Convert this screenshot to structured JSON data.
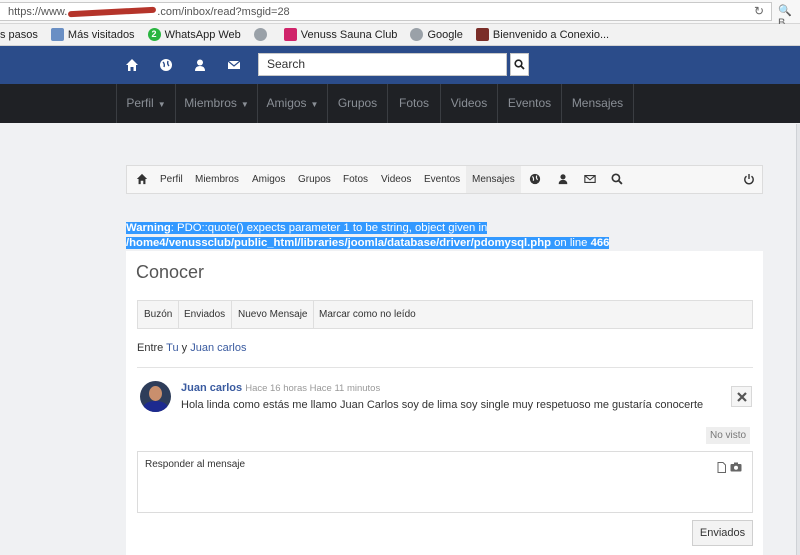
{
  "browser": {
    "url_prefix": "https://www.",
    "url_suffix": ".com/inbox/read?msgid=28",
    "reload_icon": "reload-icon",
    "search_glyph": "🔍 B"
  },
  "bookmarks": [
    {
      "label": "s pasos",
      "icon": "folder-icon"
    },
    {
      "label": "Más visitados",
      "icon": "folder-icon"
    },
    {
      "label": "WhatsApp Web",
      "icon": "whatsapp-icon"
    },
    {
      "label": "",
      "icon": "globe-icon"
    },
    {
      "label": "Venuss Sauna Club",
      "icon": "venuss-icon"
    },
    {
      "label": "Google",
      "icon": "globe-icon"
    },
    {
      "label": "Bienvenido a Conexio...",
      "icon": "joomla-icon"
    }
  ],
  "header": {
    "search_placeholder": "Search"
  },
  "nav": [
    {
      "label": "Perfil",
      "caret": true
    },
    {
      "label": "Miembros",
      "caret": true
    },
    {
      "label": "Amigos",
      "caret": true
    },
    {
      "label": "Grupos",
      "caret": false
    },
    {
      "label": "Fotos",
      "caret": false
    },
    {
      "label": "Videos",
      "caret": false
    },
    {
      "label": "Eventos",
      "caret": false
    },
    {
      "label": "Mensajes",
      "caret": false
    }
  ],
  "toolbar": {
    "items": [
      "Perfil",
      "Miembros",
      "Amigos",
      "Grupos",
      "Fotos",
      "Videos",
      "Eventos",
      "Mensajes"
    ],
    "active": "Mensajes"
  },
  "warning": {
    "label": "Warning",
    "text": ": PDO::quote() expects parameter 1 to be string, object given in ",
    "path": "/home4/venussclub/public_html/libraries/joomla/database/driver/pdomysql.php",
    "on_line": " on line ",
    "line": "466"
  },
  "inbox": {
    "title": "Conocer",
    "tabs": [
      "Buzón",
      "Enviados",
      "Nuevo Mensaje",
      "Marcar como no leído"
    ],
    "between_prefix": "Entre ",
    "between_you": "Tu",
    "between_and": " y ",
    "between_other": "Juan carlos",
    "message": {
      "author": "Juan carlos",
      "time": "Hace 16 horas Hace 11 minutos",
      "body": "Hola linda como estás me llamo Juan Carlos soy de lima soy single muy respetuoso me gustaría conocerte",
      "status": "No visto"
    },
    "reply_placeholder": "Responder al mensaje",
    "send_label": "Enviados"
  }
}
